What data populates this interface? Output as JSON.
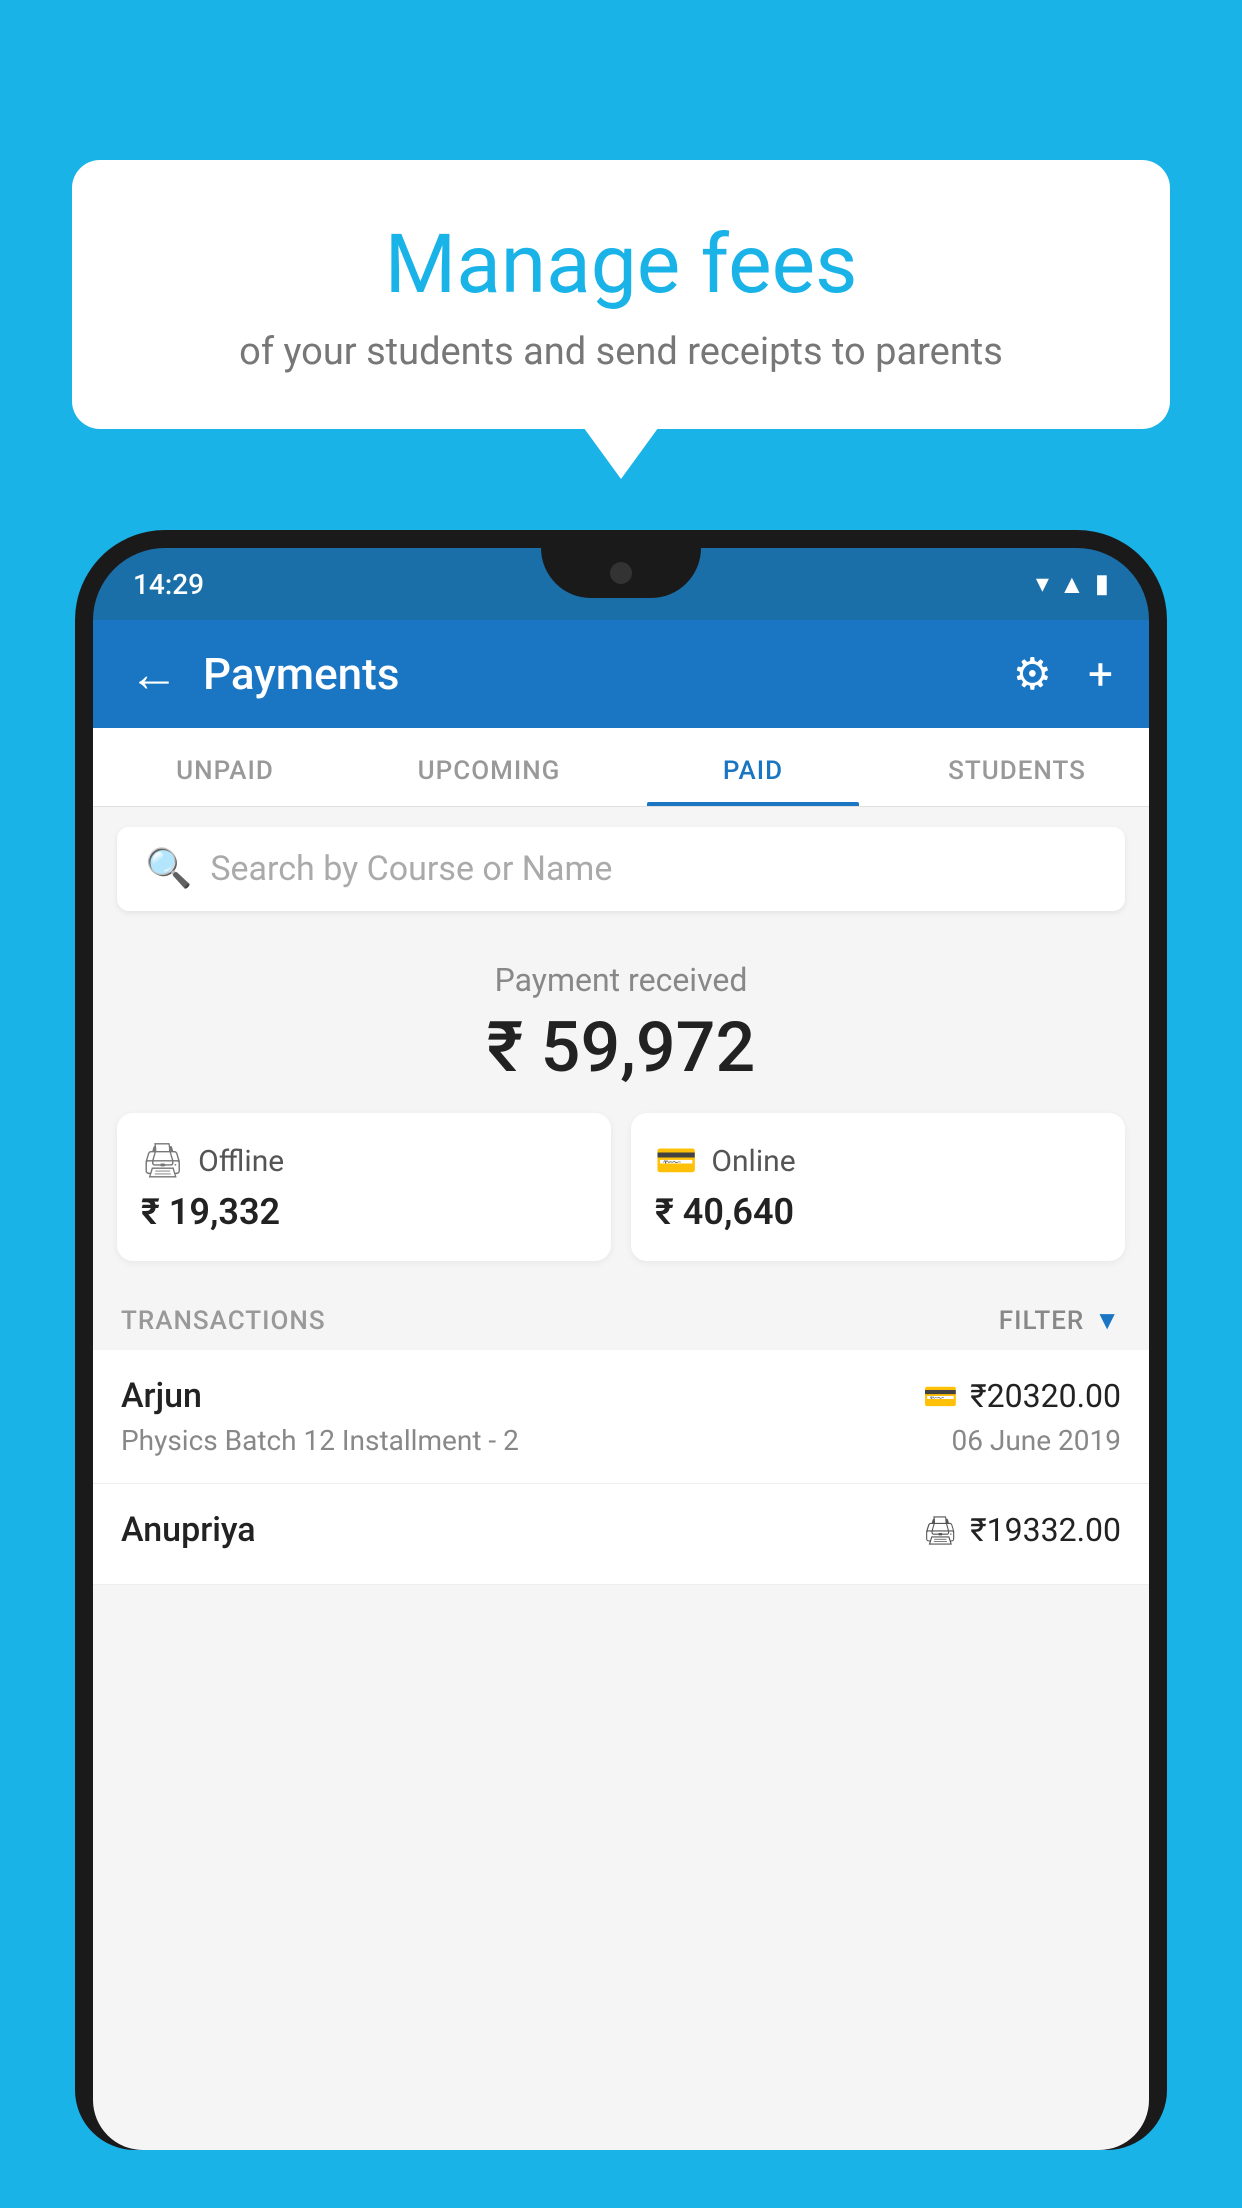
{
  "background_color": "#1ab3e8",
  "speech_bubble": {
    "title": "Manage fees",
    "subtitle": "of your students and send receipts to parents"
  },
  "status_bar": {
    "time": "14:29"
  },
  "header": {
    "title": "Payments",
    "back_icon": "←",
    "gear_icon": "⚙",
    "plus_icon": "+"
  },
  "tabs": [
    {
      "label": "UNPAID",
      "active": false
    },
    {
      "label": "UPCOMING",
      "active": false
    },
    {
      "label": "PAID",
      "active": true
    },
    {
      "label": "STUDENTS",
      "active": false
    }
  ],
  "search": {
    "placeholder": "Search by Course or Name"
  },
  "payment_summary": {
    "label": "Payment received",
    "total_amount": "₹ 59,972",
    "offline": {
      "label": "Offline",
      "amount": "₹ 19,332"
    },
    "online": {
      "label": "Online",
      "amount": "₹ 40,640"
    }
  },
  "transactions_section": {
    "label": "TRANSACTIONS",
    "filter_label": "FILTER"
  },
  "transactions": [
    {
      "name": "Arjun",
      "course": "Physics Batch 12 Installment - 2",
      "amount": "₹20320.00",
      "date": "06 June 2019",
      "mode": "online"
    },
    {
      "name": "Anupriya",
      "course": "",
      "amount": "₹19332.00",
      "date": "",
      "mode": "offline"
    }
  ]
}
